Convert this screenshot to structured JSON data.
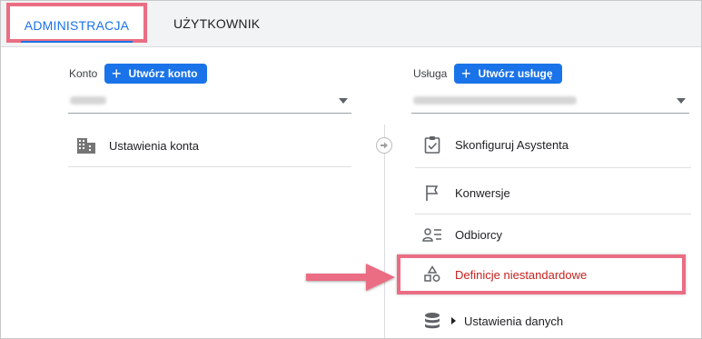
{
  "tabs": {
    "admin": "ADMINISTRACJA",
    "user": "UŻYTKOWNIK"
  },
  "account": {
    "label": "Konto",
    "create_button": "Utwórz konto",
    "items": [
      {
        "label": "Ustawienia konta",
        "icon": "building-icon"
      }
    ]
  },
  "property": {
    "label": "Usługa",
    "create_button": "Utwórz usługę",
    "items": [
      {
        "label": "Skonfiguruj Asystenta",
        "icon": "checklist-icon"
      },
      {
        "label": "Konwersje",
        "icon": "flag-icon"
      },
      {
        "label": "Odbiorcy",
        "icon": "audience-icon"
      },
      {
        "label": "Definicje niestandardowe",
        "icon": "shapes-icon"
      },
      {
        "label": "Ustawienia danych",
        "icon": "database-icon"
      }
    ]
  },
  "colors": {
    "accent": "#1a73e8",
    "highlight": "#ea6d83",
    "highlight_text": "#c5221f"
  }
}
